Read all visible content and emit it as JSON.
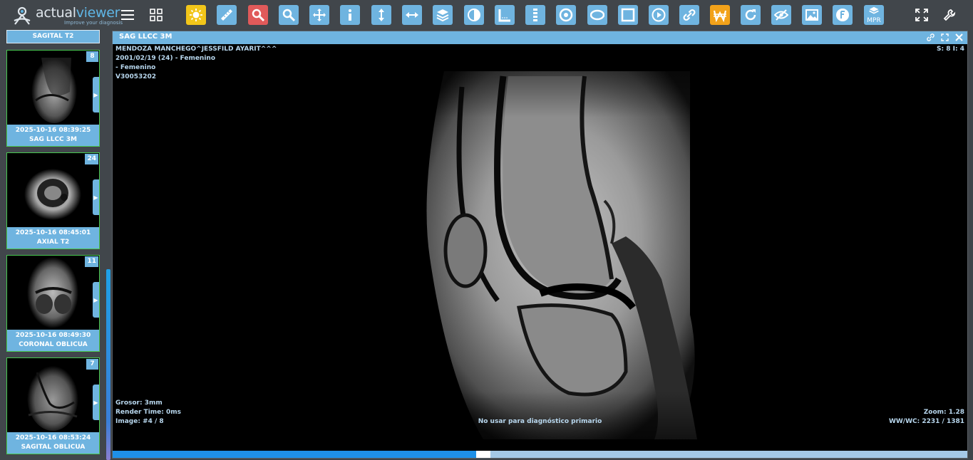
{
  "app": {
    "logo_prefix": "actual",
    "logo_suffix": "viewer",
    "logo_tagline": "Improve your diagnosis"
  },
  "toolbar": {
    "tools": [
      {
        "name": "brightness-tool",
        "icon": "sun-icon",
        "bg": "#f2c61a"
      },
      {
        "name": "ruler-tool",
        "icon": "ruler-icon",
        "bg": "#6fb4e0"
      },
      {
        "name": "magnifier-tool",
        "icon": "magnifier-icon",
        "bg": "#e05a5a"
      },
      {
        "name": "zoom-tool",
        "icon": "zoom-icon",
        "bg": "#6fb4e0"
      },
      {
        "name": "pan-tool",
        "icon": "move-arrows-icon",
        "bg": "#6fb4e0"
      },
      {
        "name": "info-tool",
        "icon": "info-icon",
        "bg": "#6fb4e0"
      },
      {
        "name": "vertical-measure-tool",
        "icon": "vertical-arrow-icon",
        "bg": "#6fb4e0"
      },
      {
        "name": "horizontal-measure-tool",
        "icon": "horizontal-arrow-icon",
        "bg": "#6fb4e0"
      },
      {
        "name": "layers-tool",
        "icon": "layers-icon",
        "bg": "#6fb4e0"
      },
      {
        "name": "invert-tool",
        "icon": "contrast-icon",
        "bg": "#6fb4e0"
      },
      {
        "name": "angle-tool",
        "icon": "angle-ruler-icon",
        "bg": "#6fb4e0"
      },
      {
        "name": "spine-tool",
        "icon": "spine-icon",
        "bg": "#6fb4e0"
      },
      {
        "name": "circle-roi-tool",
        "icon": "circle-target-icon",
        "bg": "#6fb4e0"
      },
      {
        "name": "ellipse-roi-tool",
        "icon": "ellipse-icon",
        "bg": "#6fb4e0"
      },
      {
        "name": "rectangle-roi-tool",
        "icon": "square-icon",
        "bg": "#6fb4e0"
      },
      {
        "name": "cine-tool",
        "icon": "play-icon",
        "bg": "#6fb4e0"
      },
      {
        "name": "link-tool",
        "icon": "link-icon",
        "bg": "#6fb4e0"
      },
      {
        "name": "window-level-tool",
        "icon": "w-icon",
        "bg": "#f2a21a"
      },
      {
        "name": "reset-tool",
        "icon": "rotate-icon",
        "bg": "#6fb4e0"
      },
      {
        "name": "hide-overlay-tool",
        "icon": "eye-off-icon",
        "bg": "#6fb4e0"
      },
      {
        "name": "image-export-tool",
        "icon": "image-icon",
        "bg": "#6fb4e0"
      },
      {
        "name": "filter-tool",
        "icon": "filter-f-icon",
        "bg": "#6fb4e0"
      },
      {
        "name": "mpr-tool",
        "icon": "mpr-layers-icon",
        "bg": "#6fb4e0",
        "label": "MPR"
      }
    ],
    "right_tools": [
      {
        "name": "fullscreen-button",
        "icon": "expand-icon"
      },
      {
        "name": "settings-button",
        "icon": "wrench-icon"
      }
    ]
  },
  "sidebar": {
    "top_label": "SAGITAL T2",
    "series": [
      {
        "count": "8",
        "datetime": "2025-10-16 08:39:25",
        "label": "SAG LLCC 3M",
        "type": "sagittal"
      },
      {
        "count": "24",
        "datetime": "2025-10-16 08:45:01",
        "label": "AXIAL T2",
        "type": "axial"
      },
      {
        "count": "11",
        "datetime": "2025-10-16 08:49:30",
        "label": "CORONAL OBLICUA",
        "type": "coronal"
      },
      {
        "count": "7",
        "datetime": "2025-10-16 08:53:24",
        "label": "SAGITAL OBLICUA",
        "type": "sagittal2"
      }
    ]
  },
  "viewer": {
    "title": "SAG LLCC 3M",
    "patient_name": "MENDOZA MANCHEGO^JESSFILD AYARIT^^^",
    "patient_dob": "2001/02/19 (24) - Femenino",
    "patient_sex": "- Femenino",
    "patient_id": "V30053202",
    "series_info": "S: 8 I: 4",
    "thickness": "Grosor: 3mm",
    "render_time": "Render Time: 0ms",
    "image_index": "Image: #4 / 8",
    "disclaimer": "No usar para diagnóstico primario",
    "zoom": "Zoom: 1.28",
    "window": "WW/WC: 2231 / 1381",
    "progress": 0.425
  }
}
